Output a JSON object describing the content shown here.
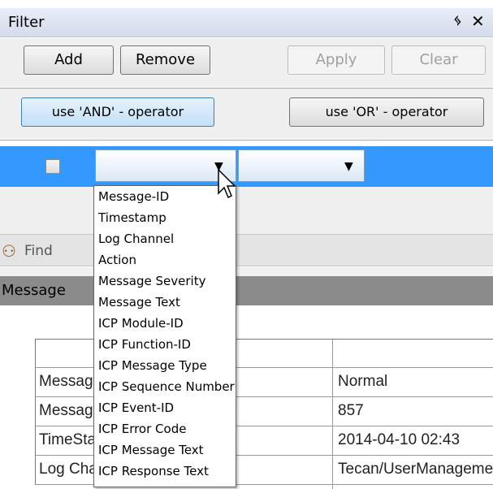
{
  "panel_title": "Filter",
  "icons": {
    "pin": "pin-icon",
    "close": "close-icon",
    "find": "binoculars-icon",
    "dropdown": "chevron-down-icon",
    "cursor": "mouse-pointer"
  },
  "toolbar": {
    "add": "Add",
    "remove": "Remove",
    "apply": "Apply",
    "clear": "Clear"
  },
  "operators": {
    "and": "use  'AND' - operator",
    "or": "use  'OR' - operator"
  },
  "filter_row": {
    "checked": false,
    "field": "",
    "condition": ""
  },
  "dropdown_items": [
    "Message-ID",
    "Timestamp",
    "Log Channel",
    "Action",
    "Message Severity",
    "Message Text",
    "ICP Module-ID",
    "ICP Function-ID",
    "ICP Message Type",
    "ICP Sequence Number",
    "ICP Event-ID",
    "ICP Error Code",
    "ICP Message Text",
    "ICP Response Text"
  ],
  "find": {
    "label": "Find"
  },
  "message_section": {
    "label": "Message"
  },
  "details_table": {
    "rows": [
      {
        "name": "Message Severity",
        "value": "Normal"
      },
      {
        "name": "Message-ID",
        "value": "857"
      },
      {
        "name": "TimeStamp",
        "value": "2014-04-10 02:43"
      },
      {
        "name": "Log Channel",
        "value": "Tecan/UserManagement"
      }
    ]
  },
  "colors": {
    "selection": "#3399ff",
    "header_dark": "#8b8b8b",
    "title_bar": "#d3dcea"
  }
}
